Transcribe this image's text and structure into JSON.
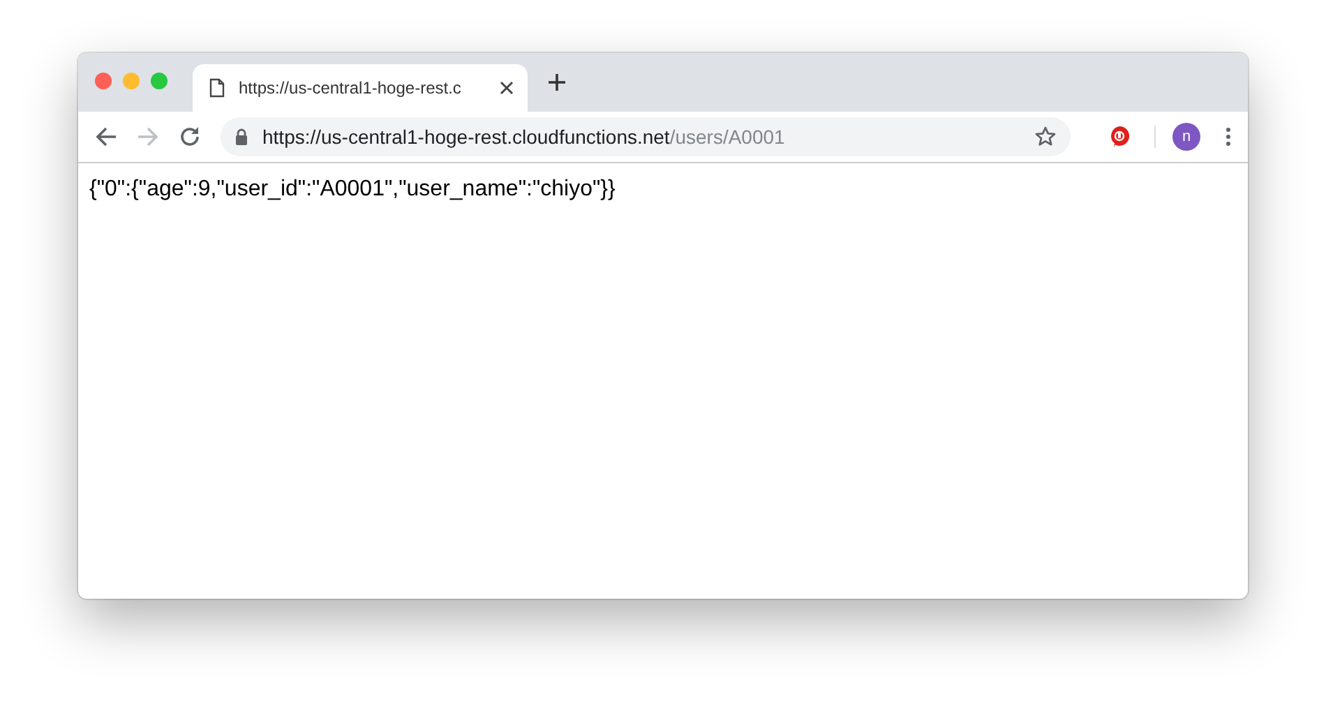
{
  "tab": {
    "title": "https://us-central1-hoge-rest.c",
    "selected": true
  },
  "address": {
    "host": "https://us-central1-hoge-rest.cloudfunctions.net",
    "path": "/users/A0001"
  },
  "profile": {
    "initial": "n"
  },
  "body": {
    "text": "{\"0\":{\"age\":9,\"user_id\":\"A0001\",\"user_name\":\"chiyo\"}}"
  }
}
